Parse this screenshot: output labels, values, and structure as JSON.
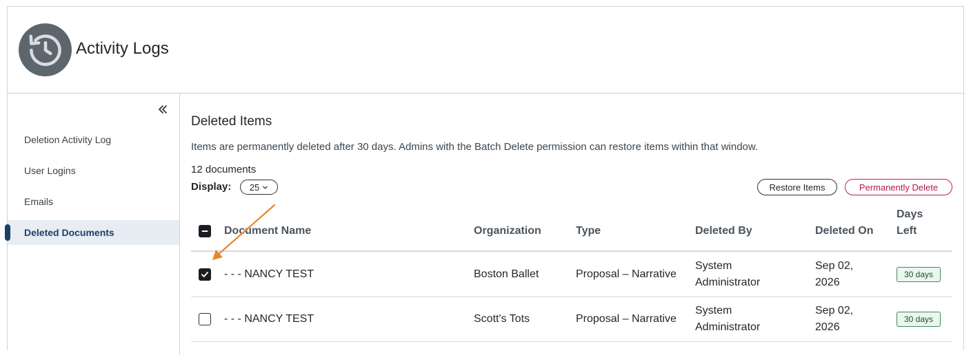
{
  "header": {
    "title": "Activity Logs",
    "logo_icon": "history-icon"
  },
  "sidebar": {
    "collapse_icon": "chevrons-left-icon",
    "items": [
      {
        "label": "Deletion Activity Log",
        "active": false
      },
      {
        "label": "User Logins",
        "active": false
      },
      {
        "label": "Emails",
        "active": false
      },
      {
        "label": "Deleted Documents",
        "active": true
      }
    ]
  },
  "main": {
    "title": "Deleted Items",
    "description": "Items are permanently deleted after 30 days. Admins with the Batch Delete permission can restore items within that window.",
    "count": "12 documents",
    "display_label": "Display:",
    "display_value": "25",
    "restore_label": "Restore Items",
    "permanent_delete_label": "Permanently Delete"
  },
  "table": {
    "columns": {
      "name": "Document Name",
      "organization": "Organization",
      "type": "Type",
      "deleted_by_1": "Deleted By",
      "deleted_on": "Deleted On",
      "days_left_1": "Days",
      "days_left_2": "Left"
    },
    "rows": [
      {
        "checked": true,
        "name": "- - - NANCY TEST",
        "organization": "Boston Ballet",
        "type": "Proposal – Narrative",
        "deleted_by_1": "System",
        "deleted_by_2": "Administrator",
        "deleted_on_1": "Sep 02,",
        "deleted_on_2": "2026",
        "days_left": "30 days"
      },
      {
        "checked": false,
        "name": "- - - NANCY TEST",
        "organization": "Scott's Tots",
        "type": "Proposal – Narrative",
        "deleted_by_1": "System",
        "deleted_by_2": "Administrator",
        "deleted_on_1": "Sep 02,",
        "deleted_on_2": "2026",
        "days_left": "30 days"
      }
    ]
  },
  "colors": {
    "accent": "#1c3f66",
    "danger": "#c2185b",
    "annotation_arrow": "#e8862a",
    "badge_green": "#3c8d5a"
  }
}
